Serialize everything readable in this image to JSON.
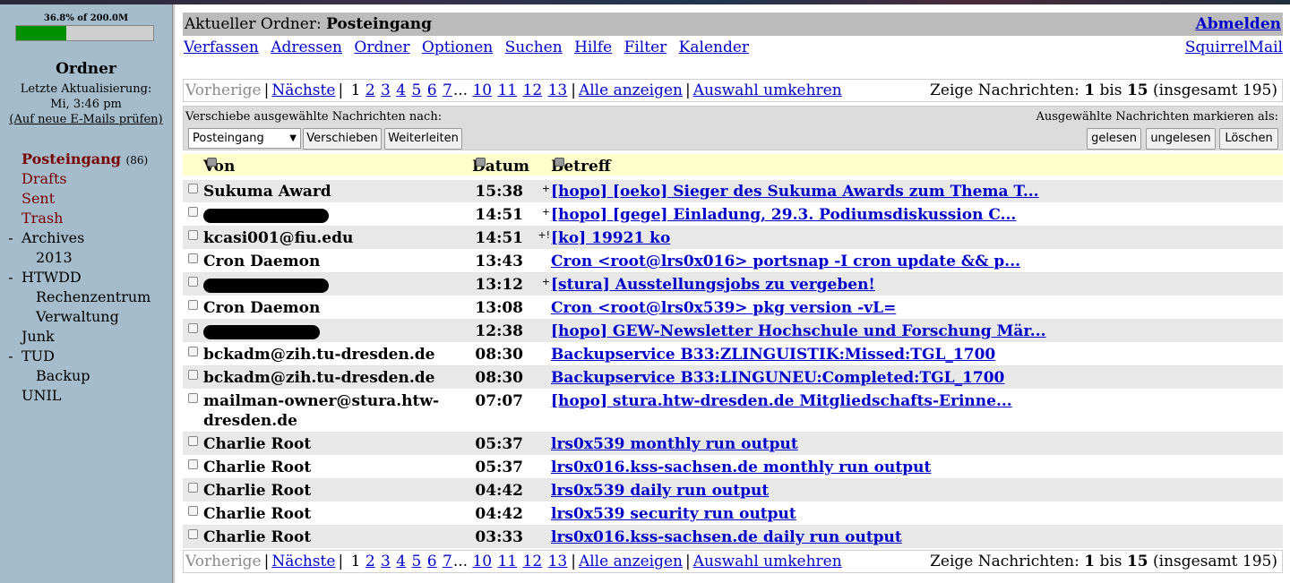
{
  "quota": {
    "text": "36.8% of 200.0M",
    "percent": 36.8
  },
  "left": {
    "title": "Ordner",
    "refresh_label": "Letzte Aktualisierung:",
    "refresh_time": "Mi, 3:46 pm",
    "check_mail": "(Auf neue E-Mails prüfen)",
    "folders": [
      {
        "label": "Posteingang",
        "count": "(86)",
        "toggle": "",
        "indent": 0
      },
      {
        "label": "Drafts",
        "toggle": "",
        "indent": 0
      },
      {
        "label": "Sent",
        "toggle": "",
        "indent": 0
      },
      {
        "label": "Trash",
        "toggle": "",
        "indent": 0
      },
      {
        "label": "Archives",
        "toggle": "-",
        "indent": 0
      },
      {
        "label": "2013",
        "toggle": "",
        "indent": 1
      },
      {
        "label": "HTWDD",
        "toggle": "-",
        "indent": 0
      },
      {
        "label": "Rechenzentrum",
        "toggle": "",
        "indent": 1
      },
      {
        "label": "Verwaltung",
        "toggle": "",
        "indent": 1
      },
      {
        "label": "Junk",
        "toggle": "",
        "indent": 0
      },
      {
        "label": "TUD",
        "toggle": "-",
        "indent": 0
      },
      {
        "label": "Backup",
        "toggle": "",
        "indent": 1
      },
      {
        "label": "UNIL",
        "toggle": "",
        "indent": 0
      }
    ]
  },
  "header": {
    "label": "Aktueller Ordner:",
    "current": "Posteingang",
    "logout": "Abmelden"
  },
  "menu": {
    "items": [
      "Verfassen",
      "Adressen",
      "Ordner",
      "Optionen",
      "Suchen",
      "Hilfe",
      "Filter",
      "Kalender"
    ],
    "brand": "SquirrelMail"
  },
  "pager": {
    "prev": "Vorherige",
    "next": "Nächste",
    "current_page": "1",
    "pages": [
      "2",
      "3",
      "4",
      "5",
      "6",
      "7"
    ],
    "ellipsis": "...",
    "pages_end": [
      "10",
      "11",
      "12",
      "13"
    ],
    "show_all": "Alle anzeigen",
    "invert": "Auswahl umkehren",
    "showing_label": "Zeige Nachrichten:",
    "from": "1",
    "to_label": "bis",
    "to": "15",
    "total": "(insgesamt 195)"
  },
  "actions": {
    "move_label": "Verschiebe ausgewählte Nachrichten nach:",
    "move_target": "Posteingang",
    "move_button": "Verschieben",
    "forward_button": "Weiterleiten",
    "mark_label": "Ausgewählte Nachrichten markieren als:",
    "read_button": "gelesen",
    "unread_button": "ungelesen",
    "delete_button": "Löschen"
  },
  "columns": {
    "from": "Von",
    "date": "Datum",
    "subject": "Betreff"
  },
  "messages": [
    {
      "from": "Sukuma Award",
      "date": "15:38",
      "flags": "+",
      "subject": "[hopo] [oeko] Sieger des Sukuma Awards zum Thema T..."
    },
    {
      "from": "",
      "redacted": true,
      "date": "14:51",
      "flags": "+",
      "subject": "[hopo] [gege] Einladung, 29.3. Podiumsdiskussion C..."
    },
    {
      "from": "kcasi001@fiu.edu",
      "date": "14:51",
      "flags": "+!",
      "subject": "[ko] 19921 ko"
    },
    {
      "from": "Cron Daemon",
      "date": "13:43",
      "flags": "",
      "subject": "Cron <root@lrs0x016> portsnap -I cron update && p..."
    },
    {
      "from": "",
      "redacted": true,
      "date": "13:12",
      "flags": "+",
      "subject": "[stura] Ausstellungsjobs zu vergeben!"
    },
    {
      "from": "Cron Daemon",
      "date": "13:08",
      "flags": "",
      "subject": "Cron <root@lrs0x539> pkg version -vL="
    },
    {
      "from": "",
      "redacted": true,
      "date": "12:38",
      "flags": "",
      "subject": "[hopo] GEW-Newsletter Hochschule und Forschung Mär..."
    },
    {
      "from": "bckadm@zih.tu-dresden.de",
      "date": "08:30",
      "flags": "",
      "subject": "Backupservice B33:ZLINGUISTIK:Missed:TGL_1700"
    },
    {
      "from": "bckadm@zih.tu-dresden.de",
      "date": "08:30",
      "flags": "",
      "subject": "Backupservice B33:LINGUNEU:Completed:TGL_1700"
    },
    {
      "from": "mailman-owner@stura.htw-dresden.de",
      "date": "07:07",
      "flags": "",
      "subject": "[hopo] stura.htw-dresden.de Mitgliedschafts-Erinne..."
    },
    {
      "from": "Charlie Root",
      "date": "05:37",
      "flags": "",
      "subject": "lrs0x539 monthly run output"
    },
    {
      "from": "Charlie Root",
      "date": "05:37",
      "flags": "",
      "subject": "lrs0x016.kss-sachsen.de monthly run output"
    },
    {
      "from": "Charlie Root",
      "date": "04:42",
      "flags": "",
      "subject": "lrs0x539 daily run output"
    },
    {
      "from": "Charlie Root",
      "date": "04:42",
      "flags": "",
      "subject": "lrs0x539 security run output"
    },
    {
      "from": "Charlie Root",
      "date": "03:33",
      "flags": "",
      "subject": "lrs0x016.kss-sachsen.de daily run output"
    }
  ]
}
